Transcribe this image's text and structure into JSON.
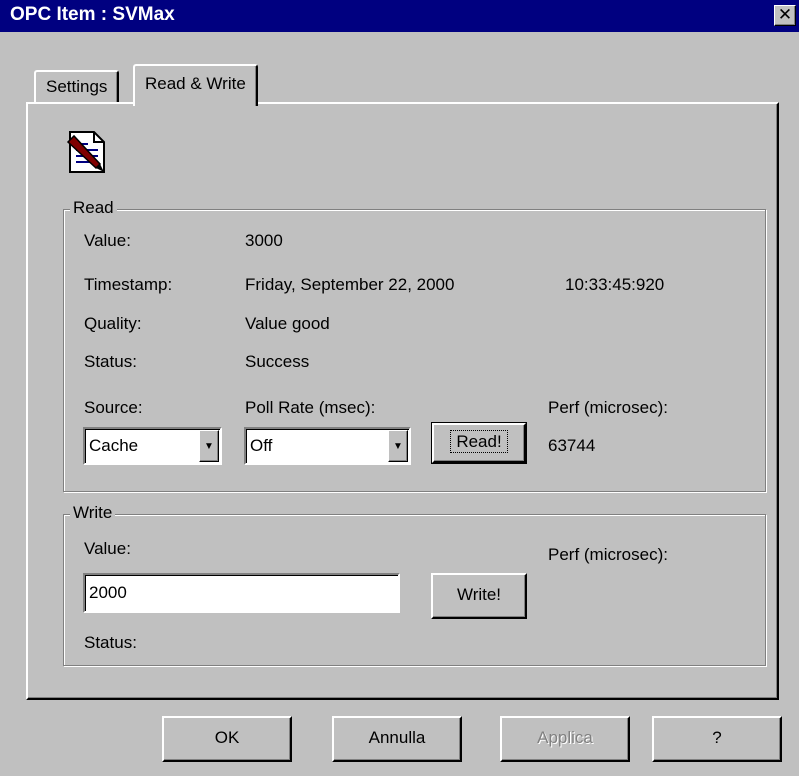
{
  "window": {
    "title": "OPC Item : SVMax",
    "close_glyph": "✕"
  },
  "tabs": [
    {
      "label": "Settings",
      "active": false
    },
    {
      "label": "Read & Write",
      "active": true
    }
  ],
  "read": {
    "group_label": "Read",
    "value_label": "Value:",
    "value": "3000",
    "timestamp_label": "Timestamp:",
    "timestamp_date": "Friday, September 22, 2000",
    "timestamp_time": "10:33:45:920",
    "quality_label": "Quality:",
    "quality": "Value good",
    "status_label": "Status:",
    "status": "Success",
    "source_label": "Source:",
    "source_value": "Cache",
    "poll_rate_label": "Poll Rate (msec):",
    "poll_rate_value": "Off",
    "read_button": "Read!",
    "perf_label": "Perf (microsec):",
    "perf_value": "63744"
  },
  "write": {
    "group_label": "Write",
    "value_label": "Value:",
    "value": "2000",
    "write_button": "Write!",
    "perf_label": "Perf (microsec):",
    "status_label": "Status:"
  },
  "footer": {
    "ok": "OK",
    "cancel": "Annulla",
    "apply": "Applica",
    "help": "?"
  },
  "icons": {
    "item_icon": "document-pen-icon",
    "dropdown_arrow": "▼"
  },
  "colors": {
    "titlebar": "#000080",
    "face": "#c0c0c0"
  }
}
